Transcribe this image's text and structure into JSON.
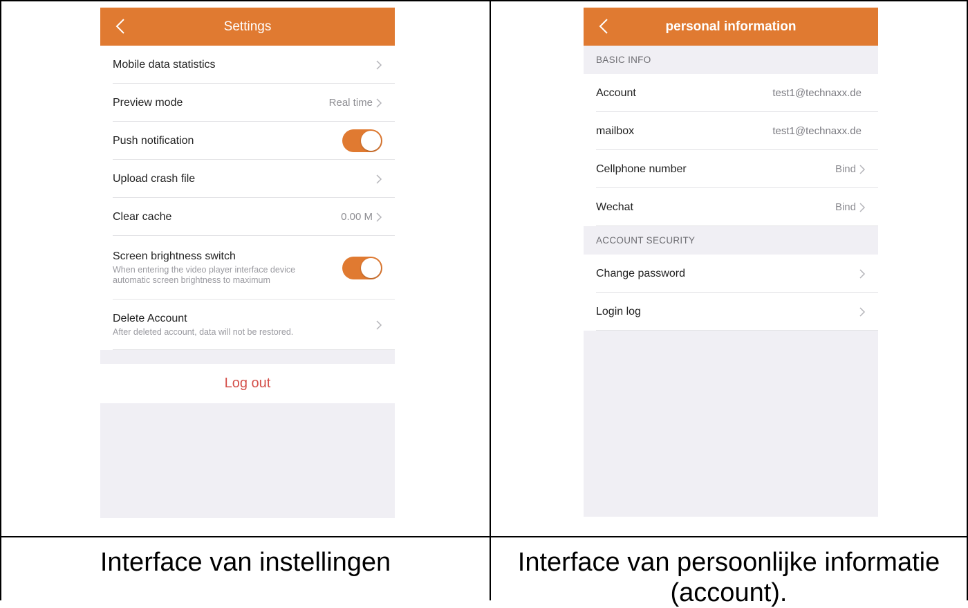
{
  "settings": {
    "title": "Settings",
    "rows": [
      {
        "label": "Mobile data statistics",
        "value": ""
      },
      {
        "label": "Preview mode",
        "value": "Real time"
      },
      {
        "label": "Push notification",
        "toggle": true
      },
      {
        "label": "Upload crash file",
        "value": ""
      },
      {
        "label": "Clear cache",
        "value": "0.00 M"
      }
    ],
    "brightness": {
      "label": "Screen brightness switch",
      "sub": "When entering the video player interface device automatic screen brightness to maximum",
      "toggle": true
    },
    "delete": {
      "label": "Delete Account",
      "sub": "After deleted account, data will not be restored."
    },
    "logout_label": "Log out"
  },
  "personal": {
    "title": "personal information",
    "basic_header": "BASIC INFO",
    "basic_rows": [
      {
        "label": "Account",
        "value": "test1@technaxx.de"
      },
      {
        "label": "mailbox",
        "value": "test1@technaxx.de"
      },
      {
        "label": "Cellphone number",
        "value": "Bind"
      },
      {
        "label": "Wechat",
        "value": "Bind"
      }
    ],
    "security_header": "ACCOUNT SECURITY",
    "security_rows": [
      {
        "label": "Change password"
      },
      {
        "label": "Login log"
      }
    ]
  },
  "captions": {
    "left": "Interface van instellingen",
    "right": "Interface van persoonlijke informatie (account)."
  },
  "colors": {
    "accent": "#e07a31",
    "logout": "#d4504a",
    "background": "#f0eff4"
  }
}
